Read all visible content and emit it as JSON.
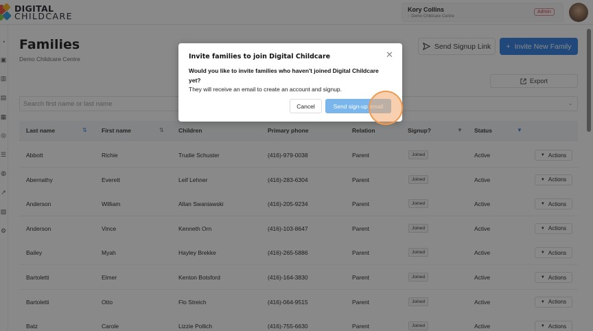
{
  "brand": {
    "line1": "DIGITAL",
    "line2": "CHILDCARE"
  },
  "user": {
    "name": "Kory Collins",
    "centre": "Demo Childcare Centre",
    "role_badge": "Admin"
  },
  "page": {
    "title": "Families",
    "subtitle": "Demo Childcare Centre"
  },
  "toolbar": {
    "send_signup_link": "Send Signup Link",
    "invite_new_family": "Invite New Family",
    "export": "Export"
  },
  "search": {
    "placeholder": "Search first name or last name"
  },
  "table": {
    "headers": [
      "Last name",
      "First name",
      "Children",
      "Primary phone",
      "Relation",
      "Signup?",
      "Status"
    ],
    "rows": [
      {
        "last": "Abbott",
        "first": "Richie",
        "children": "Trudie Schuster",
        "phone": "(416)-979-0038",
        "relation": "Parent",
        "signup": "Joined",
        "status": "Active",
        "action": "Actions"
      },
      {
        "last": "Abernathy",
        "first": "Everett",
        "children": "Leif Lehner",
        "phone": "(416)-283-6304",
        "relation": "Parent",
        "signup": "Joined",
        "status": "Active",
        "action": "Actions"
      },
      {
        "last": "Anderson",
        "first": "William",
        "children": "Allan Swaniawski",
        "phone": "(416)-205-9234",
        "relation": "Parent",
        "signup": "Joined",
        "status": "Active",
        "action": "Actions"
      },
      {
        "last": "Anderson",
        "first": "Vince",
        "children": "Kenneth Orn",
        "phone": "(416)-103-8647",
        "relation": "Parent",
        "signup": "Joined",
        "status": "Active",
        "action": "Actions"
      },
      {
        "last": "Bailey",
        "first": "Myah",
        "children": "Hayley Brekke",
        "phone": "(416)-265-5886",
        "relation": "Parent",
        "signup": "Joined",
        "status": "Active",
        "action": "Actions"
      },
      {
        "last": "Bartoletti",
        "first": "Elmer",
        "children": "Kenton Botsford",
        "phone": "(416)-164-3830",
        "relation": "Parent",
        "signup": "Joined",
        "status": "Active",
        "action": "Actions"
      },
      {
        "last": "Bartoletti",
        "first": "Otto",
        "children": "Flo Streich",
        "phone": "(416)-064-9515",
        "relation": "Parent",
        "signup": "Joined",
        "status": "Active",
        "action": "Actions"
      },
      {
        "last": "Batz",
        "first": "Carole",
        "children": "Lizzie Pollich",
        "phone": "(416)-755-6630",
        "relation": "Parent",
        "signup": "Joined",
        "status": "Active",
        "action": "Actions"
      }
    ]
  },
  "modal": {
    "title": "Invite families to join Digital Childcare",
    "question": "Would you like to invite families who haven't joined Digital Childcare yet?",
    "body": "They will receive an email to create an account and signup.",
    "cancel_label": "Cancel",
    "send_label": "Send sign-up email",
    "close_icon": "close-icon"
  },
  "colors": {
    "primary": "#2f7de1",
    "primary_disabled": "#7ab6ec",
    "admin_badge": "#c0354a",
    "click_highlight": "#ee9a4f"
  }
}
